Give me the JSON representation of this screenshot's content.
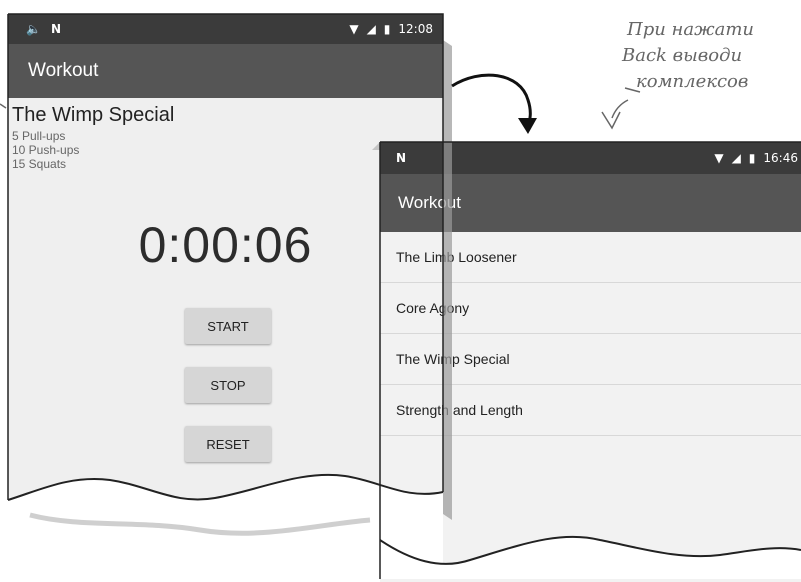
{
  "screen1": {
    "status": {
      "time": "12:08"
    },
    "app_title": "Workout",
    "workout_title": "The Wimp Special",
    "workout_lines": [
      "5 Pull-ups",
      "10 Push-ups",
      "15 Squats"
    ],
    "timer": "0:00:06",
    "buttons": {
      "start": "START",
      "stop": "STOP",
      "reset": "RESET"
    }
  },
  "screen2": {
    "status": {
      "time": "16:46"
    },
    "app_title": "Workout",
    "items": [
      "The Limb Loosener",
      "Core Agony",
      "The Wimp Special",
      "Strength and Length"
    ]
  },
  "annotation": {
    "lines": [
      "При нажати",
      "Back выводи",
      "комплексов "
    ]
  },
  "colors": {
    "statusbar": "#3b3b3b",
    "appbar": "#555555",
    "background": "#efefef"
  }
}
